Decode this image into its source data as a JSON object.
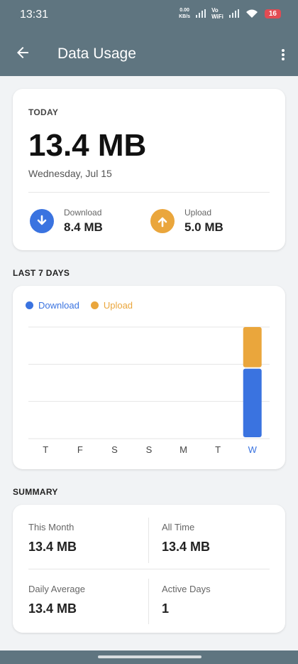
{
  "status": {
    "time": "13:31",
    "netspeed_value": "0.00",
    "netspeed_unit": "KB/s",
    "vo_label": "Vo",
    "wifi_label": "WiFi",
    "battery": "16"
  },
  "header": {
    "title": "Data Usage",
    "back_icon": "arrow-left-icon",
    "menu_icon": "more-vert-icon"
  },
  "today": {
    "label": "TODAY",
    "total": "13.4 MB",
    "date": "Wednesday, Jul 15",
    "download_label": "Download",
    "download_value": "8.4 MB",
    "upload_label": "Upload",
    "upload_value": "5.0 MB"
  },
  "last7": {
    "title": "LAST 7 DAYS"
  },
  "chart_data": {
    "type": "bar",
    "stacked": true,
    "categories": [
      "T",
      "F",
      "S",
      "S",
      "M",
      "T",
      "W"
    ],
    "highlight_index": 6,
    "series": [
      {
        "name": "Download",
        "color": "#3a73e0",
        "values": [
          0,
          0,
          0,
          0,
          0,
          0,
          8.4
        ]
      },
      {
        "name": "Upload",
        "color": "#eaa63c",
        "values": [
          0,
          0,
          0,
          0,
          0,
          0,
          5.0
        ]
      }
    ],
    "ylim": [
      0,
      13.4
    ],
    "grid": true,
    "legend_position": "top-left"
  },
  "summary": {
    "title": "SUMMARY",
    "this_month_label": "This Month",
    "this_month_value": "13.4 MB",
    "all_time_label": "All Time",
    "all_time_value": "13.4 MB",
    "daily_avg_label": "Daily Average",
    "daily_avg_value": "13.4 MB",
    "active_days_label": "Active Days",
    "active_days_value": "1"
  },
  "colors": {
    "header_bg": "#5f7580",
    "download": "#3a73e0",
    "upload": "#eaa63c",
    "battery": "#e24b53"
  }
}
